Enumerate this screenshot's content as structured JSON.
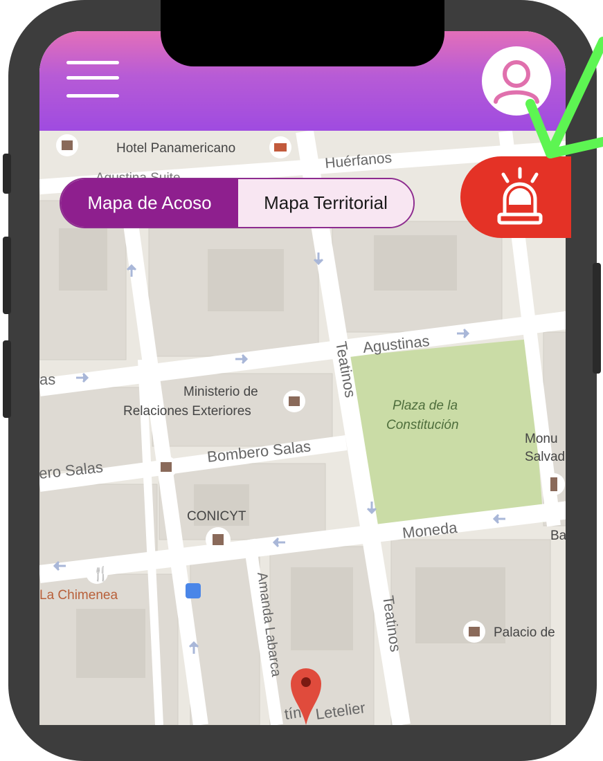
{
  "header": {
    "menu_icon": "hamburger-menu-icon",
    "profile_icon": "user-profile-icon"
  },
  "map_toggle": {
    "active_label": "Mapa de Acoso",
    "inactive_label": "Mapa Territorial"
  },
  "alert_button": {
    "icon": "alarm-siren-icon",
    "color": "#e43226"
  },
  "map": {
    "streets": {
      "huerfanos": "Huérfanos",
      "agustinas": "Agustinas",
      "agustinas_partial": "as",
      "teatinos_upper": "Teatinos",
      "teatinos_lower": "Teatinos",
      "bombero_salas": "Bombero Salas",
      "bombero_salas_partial": "ero Salas",
      "moneda": "Moneda",
      "amanda_labarca": "Amanda Labarca",
      "letelier": "Letelier",
      "letelier_prefix": "tín"
    },
    "places": {
      "hotel": "Hotel Panamericano",
      "agustina_suite": "Agustina Suite",
      "ministerio_line1": "Ministerio de",
      "ministerio_line2": "Relaciones Exteriores",
      "plaza_line1": "Plaza de la",
      "plaza_line2": "Constitución",
      "monumento_line1": "Monu",
      "monumento_line2": "Salvad",
      "conicyt": "CONICYT",
      "chimenea": "La Chimenea",
      "palacio": "Palacio de",
      "ba_partial": "Ba"
    }
  },
  "accent_colors": {
    "header_top": "#e36fb9",
    "header_bottom": "#9f4be0",
    "toggle_active": "#8e1f8e",
    "toggle_inactive": "#f8e6f2",
    "annotation_check": "#5df552"
  }
}
